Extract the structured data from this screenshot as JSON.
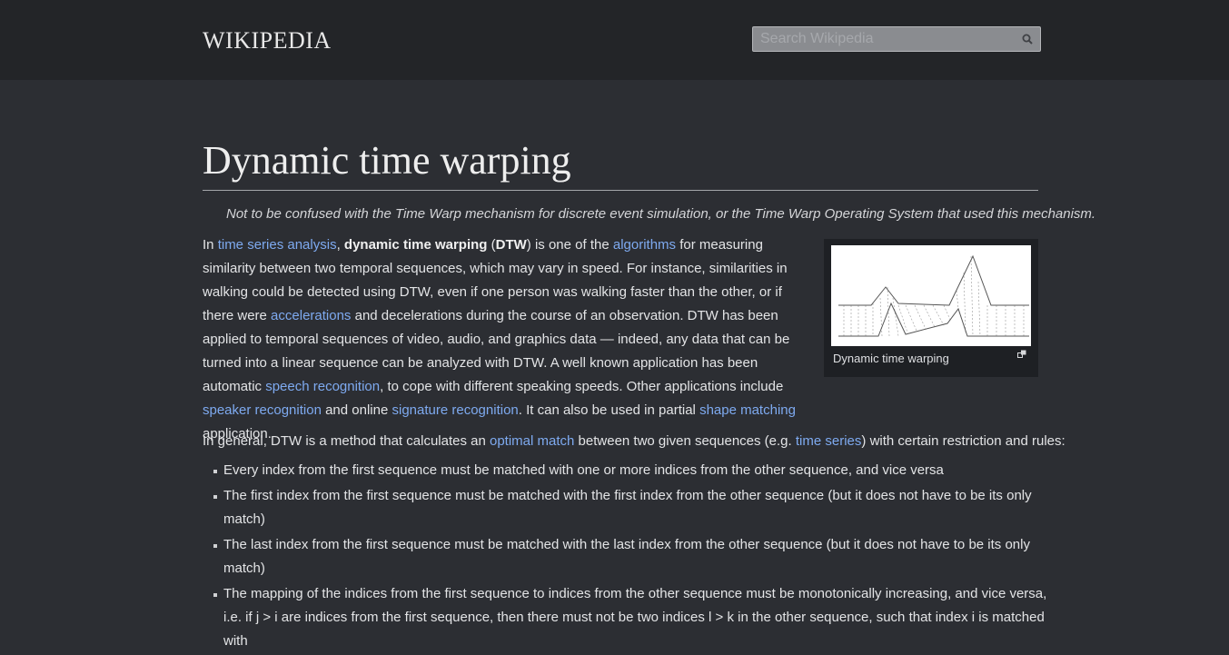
{
  "header": {
    "logo": "WIKIPEDIA",
    "search_placeholder": "Search Wikipedia"
  },
  "article": {
    "title": "Dynamic time warping",
    "hatnote": "Not to be confused with the Time Warp mechanism for discrete event simulation, or the Time Warp Operating System that used this mechanism.",
    "p1": {
      "t1": "In ",
      "link_time_series_analysis": "time series analysis",
      "t2": ", ",
      "b_dtw": "dynamic time warping",
      "t3": " (",
      "b_abbr": "DTW",
      "t4": ") is one of the ",
      "link_algorithms": "algorithms",
      "t5": " for measuring similarity between two temporal sequences, which may vary in speed. For instance, similarities in walking could be detected using DTW, even if one person was walking faster than the other, or if there were ",
      "link_accelerations": "accelerations",
      "t6": " and decelerations during the course of an observation. DTW has been applied to temporal sequences of video, audio, and graphics data — indeed, any data that can be turned into a linear sequence can be analyzed with DTW. A well known application has been automatic ",
      "link_speech_recognition": "speech recognition",
      "t7": ", to cope with different speaking speeds. Other applications include ",
      "link_speaker_recognition": "speaker recognition",
      "t8": " and online ",
      "link_signature_recognition": "signature recognition",
      "t9": ". It can also be used in partial ",
      "link_shape_matching": "shape matching",
      "t10": " application."
    },
    "thumb_caption": "Dynamic time warping",
    "p2": {
      "t1": "In general, DTW is a method that calculates an ",
      "link_optimal_match": "optimal match",
      "t2": " between two given sequences (e.g. ",
      "link_time_series": "time series",
      "t3": ") with certain restriction and rules:"
    },
    "rules": [
      "Every index from the first sequence must be matched with one or more indices from the other sequence, and vice versa",
      "The first index from the first sequence must be matched with the first index from the other sequence (but it does not have to be its only match)",
      "The last index from the first sequence must be matched with the last index from the other sequence (but it does not have to be its only match)",
      "The mapping of the indices from the first sequence to indices from the other sequence must be monotonically increasing, and vice versa, i.e. if j > i are indices from the first sequence, then there must not be two indices l > k in the other sequence, such that index i is matched with"
    ]
  }
}
